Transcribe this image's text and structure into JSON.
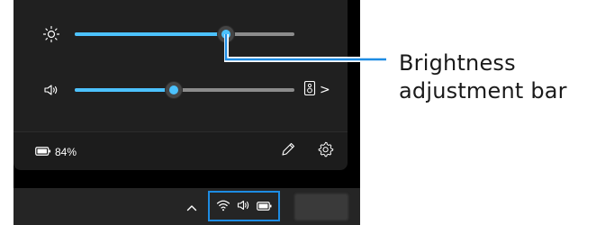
{
  "quick_settings": {
    "brightness": {
      "icon": "brightness-icon",
      "level": 0.69
    },
    "volume": {
      "icon": "volume-icon",
      "level": 0.45
    },
    "output_device": {
      "icon": "speaker-icon",
      "chevron": ">"
    },
    "battery": {
      "icon": "battery-icon",
      "percent": "84%"
    },
    "edit_button": {
      "icon": "pencil-icon"
    },
    "settings_button": {
      "icon": "gear-icon"
    }
  },
  "taskbar": {
    "tray_chevron": "^",
    "tray_icons": [
      "wifi-icon",
      "volume-icon",
      "battery-icon"
    ]
  },
  "callout": {
    "line1": "Brightness",
    "line2": "adjustment bar"
  },
  "colors": {
    "accent": "#4cc2ff",
    "highlight_box": "#1d8ce3",
    "panel_bg": "#202020",
    "taskbar_bg": "#252525"
  }
}
